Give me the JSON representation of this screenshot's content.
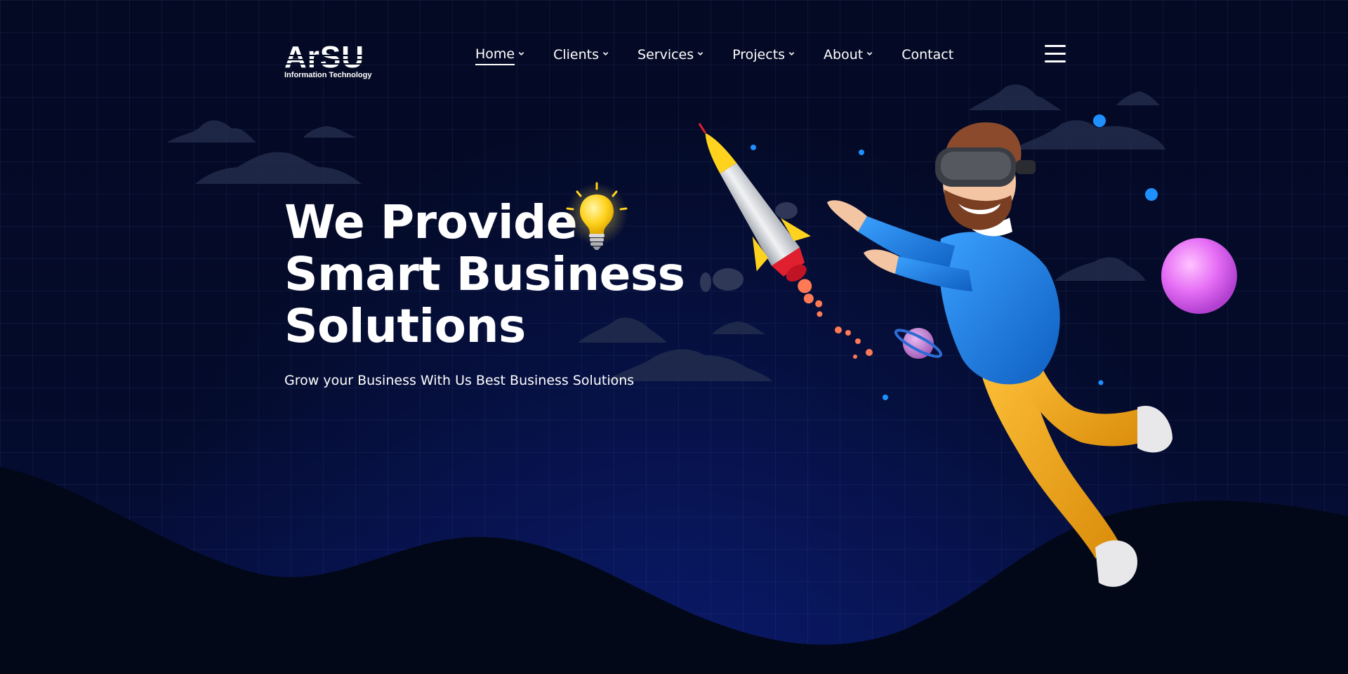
{
  "brand": {
    "logo_text": "ArSU",
    "logo_tagline": "Information Technology"
  },
  "nav": {
    "items": [
      {
        "label": "Home",
        "has_dropdown": true,
        "active": true
      },
      {
        "label": "Clients",
        "has_dropdown": true,
        "active": false
      },
      {
        "label": "Services",
        "has_dropdown": true,
        "active": false
      },
      {
        "label": "Projects",
        "has_dropdown": true,
        "active": false
      },
      {
        "label": "About",
        "has_dropdown": true,
        "active": false
      },
      {
        "label": "Contact",
        "has_dropdown": false,
        "active": false
      }
    ],
    "menu_icon": "hamburger-icon"
  },
  "hero": {
    "title_lines": [
      "We Provide",
      "Smart Business",
      "Solutions"
    ],
    "subtitle": "Grow your Business With Us Best Business Solutions",
    "decoration_icon": "lightbulb-icon"
  },
  "illustration": {
    "subject": "vr-character-with-rocket"
  },
  "colors": {
    "background": "#040a24",
    "background_glow": "#0a1a6b",
    "text": "#ffffff",
    "bulb": "#ffd21e",
    "planet_pink": "#e66ef5",
    "dot_blue": "#1e90ff",
    "sweater": "#1d7fe0",
    "pants": "#f1a51c"
  }
}
